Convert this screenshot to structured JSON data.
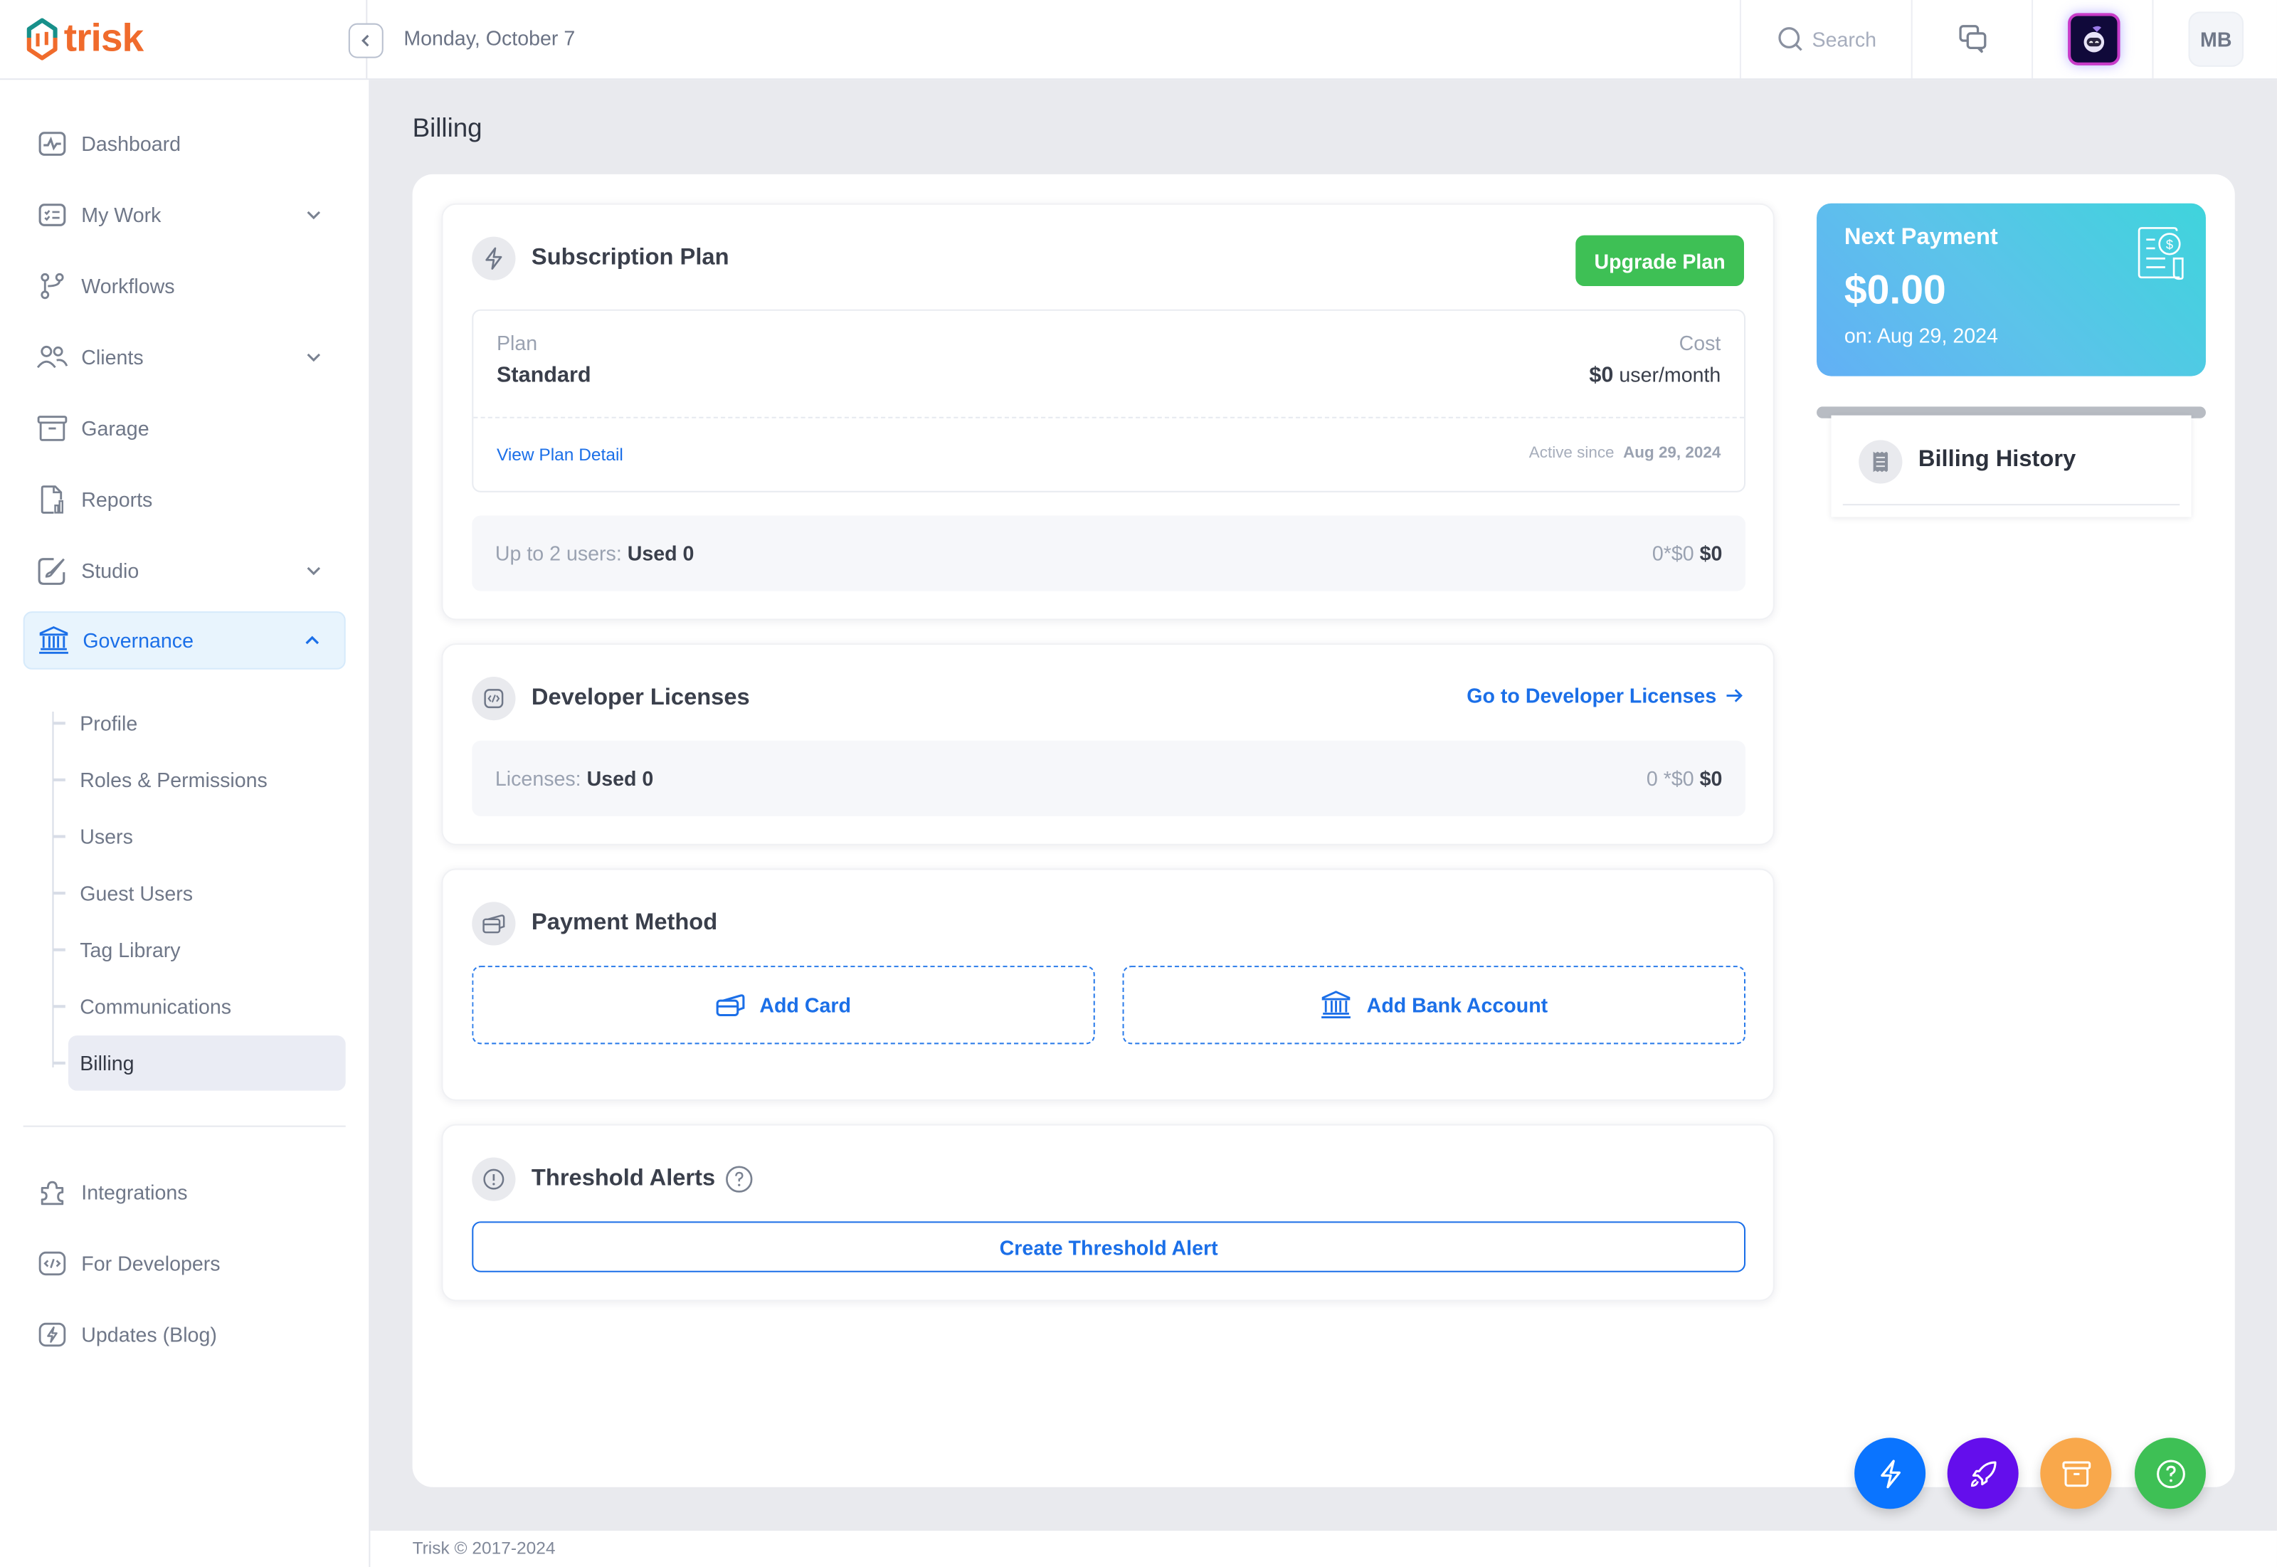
{
  "app": {
    "name": "trisk",
    "date": "Monday, October 7"
  },
  "topbar": {
    "search_placeholder": "Search",
    "user_initials": "MB"
  },
  "sidebar": {
    "items": [
      {
        "label": "Dashboard",
        "icon": "activity-icon"
      },
      {
        "label": "My Work",
        "icon": "checklist-icon",
        "expandable": true
      },
      {
        "label": "Workflows",
        "icon": "git-branch-icon"
      },
      {
        "label": "Clients",
        "icon": "users-icon",
        "expandable": true
      },
      {
        "label": "Garage",
        "icon": "archive-icon"
      },
      {
        "label": "Reports",
        "icon": "report-icon"
      },
      {
        "label": "Studio",
        "icon": "brush-icon",
        "expandable": true
      },
      {
        "label": "Governance",
        "icon": "bank-icon",
        "expanded": true,
        "active": true
      }
    ],
    "governance_sub": [
      "Profile",
      "Roles & Permissions",
      "Users",
      "Guest Users",
      "Tag Library",
      "Communications",
      "Billing"
    ],
    "active_sub": "Billing",
    "bottom_items": [
      {
        "label": "Integrations",
        "icon": "puzzle-icon"
      },
      {
        "label": "For Developers",
        "icon": "code-icon"
      },
      {
        "label": "Updates (Blog)",
        "icon": "bolt-icon"
      }
    ]
  },
  "page": {
    "title": "Billing"
  },
  "subscription": {
    "title": "Subscription Plan",
    "upgrade_label": "Upgrade Plan",
    "plan_label": "Plan",
    "plan_value": "Standard",
    "cost_label": "Cost",
    "cost_amount": "$0",
    "cost_unit": "user/month",
    "view_detail": "View Plan Detail",
    "active_since_label": "Active since",
    "active_since_date": "Aug 29, 2024",
    "usage_label": "Up to 2 users:",
    "usage_used": "Used 0",
    "usage_calc": "0*$0",
    "usage_total": "$0"
  },
  "developer_licenses": {
    "title": "Developer Licenses",
    "link": "Go to Developer Licenses",
    "usage_label": "Licenses:",
    "usage_used": "Used 0",
    "usage_calc": "0 *$0",
    "usage_total": "$0"
  },
  "payment_method": {
    "title": "Payment Method",
    "add_card": "Add Card",
    "add_bank": "Add Bank Account"
  },
  "threshold": {
    "title": "Threshold Alerts",
    "create": "Create Threshold Alert"
  },
  "next_payment": {
    "title": "Next Payment",
    "amount": "$0.00",
    "date": "on: Aug 29, 2024"
  },
  "billing_history": {
    "title": "Billing History"
  },
  "footer": {
    "copyright": "Trisk © 2017-2024"
  },
  "fabs": [
    {
      "name": "quick-actions",
      "color": "#0a74ff"
    },
    {
      "name": "launch",
      "color": "#640eec"
    },
    {
      "name": "archive",
      "color": "#f9a84b"
    },
    {
      "name": "help",
      "color": "#3ec055"
    }
  ],
  "colors": {
    "accent": "#1b6fe8",
    "success": "#3ec055",
    "brand": "#f06b2c"
  }
}
